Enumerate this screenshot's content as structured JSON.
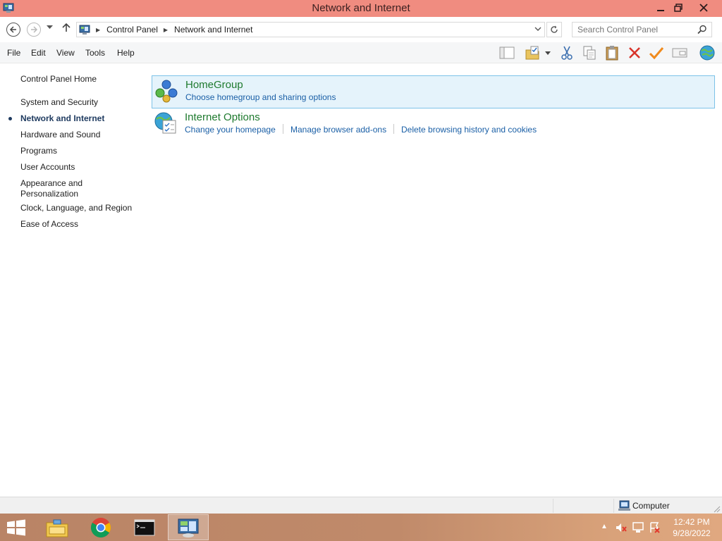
{
  "window": {
    "title": "Network and Internet",
    "title_bar_color": "#f08c80"
  },
  "address_bar": {
    "breadcrumbs": [
      "Control Panel",
      "Network and Internet"
    ],
    "search_placeholder": "Search Control Panel"
  },
  "menu": {
    "items": [
      "File",
      "Edit",
      "View",
      "Tools",
      "Help"
    ]
  },
  "toolbar": {
    "icons": [
      "pane-icon",
      "folder-options-icon",
      "cut-icon",
      "copy-icon",
      "paste-icon",
      "delete-icon",
      "checkmark-icon",
      "properties-icon",
      "internet-icon"
    ]
  },
  "sidebar": {
    "items": [
      {
        "label": "Control Panel Home",
        "current": false
      },
      {
        "label": "System and Security",
        "current": false
      },
      {
        "label": "Network and Internet",
        "current": true
      },
      {
        "label": "Hardware and Sound",
        "current": false
      },
      {
        "label": "Programs",
        "current": false
      },
      {
        "label": "User Accounts",
        "current": false
      },
      {
        "label": "Appearance and Personalization",
        "current": false
      },
      {
        "label": "Clock, Language, and Region",
        "current": false
      },
      {
        "label": "Ease of Access",
        "current": false
      }
    ]
  },
  "categories": [
    {
      "title": "HomeGroup",
      "links": [
        "Choose homegroup and sharing options"
      ]
    },
    {
      "title": "Internet Options",
      "links": [
        "Change your homepage",
        "Manage browser add-ons",
        "Delete browsing history and cookies"
      ]
    }
  ],
  "statusbar": {
    "location": "Computer"
  },
  "taskbar": {
    "apps": [
      "file-explorer-icon",
      "chrome-icon",
      "command-prompt-icon",
      "control-panel-icon"
    ],
    "clock": {
      "time": "12:42 PM",
      "date": "9/28/2022"
    }
  },
  "colors": {
    "link": "#1a5fa6",
    "category_title": "#1e7a2e",
    "highlight_bg": "#e5f3fb",
    "highlight_border": "#7dc2e8"
  }
}
